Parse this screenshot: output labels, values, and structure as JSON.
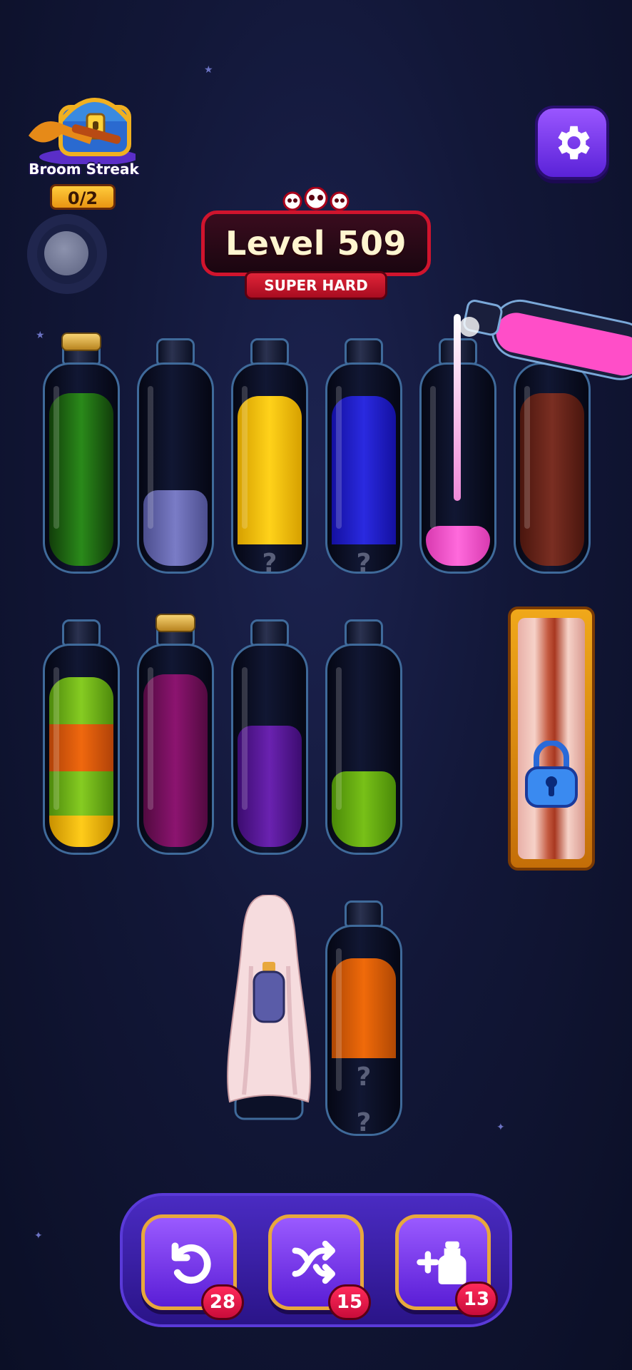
{
  "streak": {
    "label": "Broom Streak",
    "count": "0/2"
  },
  "level": {
    "title": "Level 509",
    "difficulty": "SUPER HARD"
  },
  "hidden_marker": "?",
  "bottles": [
    {
      "id": "b1",
      "corked": true,
      "layers_bottom_up": [
        "#1e6a12",
        "#1e6a12",
        "#1e6a12",
        "#1e6a12"
      ]
    },
    {
      "id": "b2",
      "corked": false,
      "layers_bottom_up": [
        "#6d6fb8",
        "#6d6fb8"
      ]
    },
    {
      "id": "b3",
      "corked": false,
      "layers_bottom_up": [
        "hidden",
        "yellow",
        "yellow",
        "yellow"
      ]
    },
    {
      "id": "b4",
      "corked": false,
      "layers_bottom_up": [
        "hidden",
        "blue",
        "blue",
        "blue"
      ]
    },
    {
      "id": "b5",
      "corked": false,
      "layers_bottom_up": [
        "pink"
      ]
    },
    {
      "id": "b6",
      "corked": false,
      "layers_bottom_up": [
        "#6a2418",
        "#6a2418",
        "#6a2418",
        "#6a2418"
      ]
    },
    {
      "id": "b7",
      "corked": false,
      "layers_bottom_up": [
        "#f0c012",
        "#7cbc1a",
        "#e05a0c",
        "#7cbc1a"
      ]
    },
    {
      "id": "b8",
      "corked": true,
      "layers_bottom_up": [
        "#7a1060",
        "#7a1060",
        "#7a1060",
        "#7a1060"
      ]
    },
    {
      "id": "b9",
      "corked": false,
      "layers_bottom_up": [
        "#5a1898",
        "#5a1898",
        "#5a1898"
      ]
    },
    {
      "id": "b10",
      "corked": false,
      "layers_bottom_up": [
        "#6cb012",
        "#6cb012"
      ]
    },
    {
      "id": "b11",
      "state": "covered by sheet"
    },
    {
      "id": "b12",
      "corked": false,
      "layers_bottom_up": [
        "hidden",
        "hidden",
        "#e0600a",
        "#e0600a"
      ]
    }
  ],
  "locked_slot": {
    "state": "locked"
  },
  "boosters": [
    {
      "name": "undo",
      "count": "28",
      "icon": "undo-icon"
    },
    {
      "name": "shuffle",
      "count": "15",
      "icon": "shuffle-icon"
    },
    {
      "name": "add-bottle",
      "count": "13",
      "icon": "add-bottle-icon"
    }
  ],
  "colors": {
    "accent": "#7b3cf0",
    "level_frame": "#d0142d",
    "badge": "#e0143c"
  }
}
